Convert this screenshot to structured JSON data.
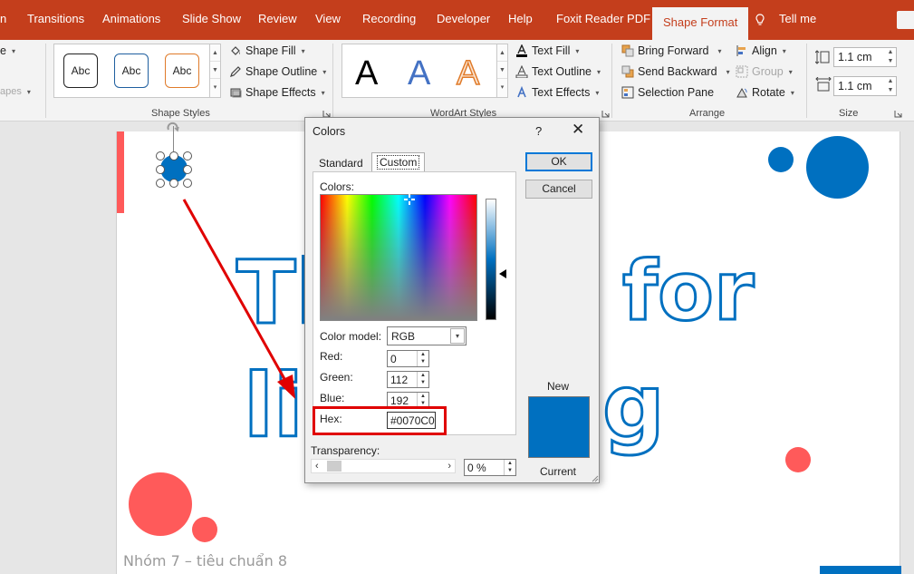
{
  "ribbon": {
    "tabs": [
      "n",
      "Transitions",
      "Animations",
      "Slide Show",
      "Review",
      "View",
      "Recording",
      "Developer",
      "Help",
      "Foxit Reader PDF",
      "Shape Format",
      "Tell me"
    ],
    "active_tab": "Shape Format",
    "partial_left_top": "e",
    "partial_left_bottom": "apes",
    "shape_styles": {
      "label": "Shape Styles",
      "previews": [
        "Abc",
        "Abc",
        "Abc"
      ],
      "shape_fill": "Shape Fill",
      "shape_outline": "Shape Outline",
      "shape_effects": "Shape Effects"
    },
    "wordart_styles": {
      "label": "WordArt Styles",
      "letters": [
        "A",
        "A",
        "A"
      ],
      "text_fill": "Text Fill",
      "text_outline": "Text Outline",
      "text_effects": "Text Effects"
    },
    "arrange": {
      "label": "Arrange",
      "bring_forward": "Bring Forward",
      "send_backward": "Send Backward",
      "selection_pane": "Selection Pane",
      "align": "Align",
      "group": "Group",
      "rotate": "Rotate"
    },
    "size": {
      "label": "Size",
      "height": "1.1 cm",
      "width": "1.1 cm"
    }
  },
  "slide": {
    "title_line1": "Th",
    "title_line1_end": "for",
    "title_line2_start": "li",
    "title_line2_end": "g",
    "footer": "Nhóm 7 – tiêu chuẩn 8",
    "colors": {
      "accent_red": "#ff5a5a",
      "brand_blue": "#0070c0"
    }
  },
  "dialog": {
    "title": "Colors",
    "help": "?",
    "tabs": [
      "Standard",
      "Custom"
    ],
    "active_tab": "Custom",
    "colors_label": "Colors:",
    "color_model_label": "Color model:",
    "color_model_value": "RGB",
    "red_label": "Red:",
    "red_value": "0",
    "green_label": "Green:",
    "green_value": "112",
    "blue_label": "Blue:",
    "blue_value": "192",
    "hex_label": "Hex:",
    "hex_value": "#0070C0",
    "transparency_label": "Transparency:",
    "transparency_value": "0 %",
    "ok": "OK",
    "cancel": "Cancel",
    "new_label": "New",
    "current_label": "Current",
    "new_color": "#0070c0"
  }
}
